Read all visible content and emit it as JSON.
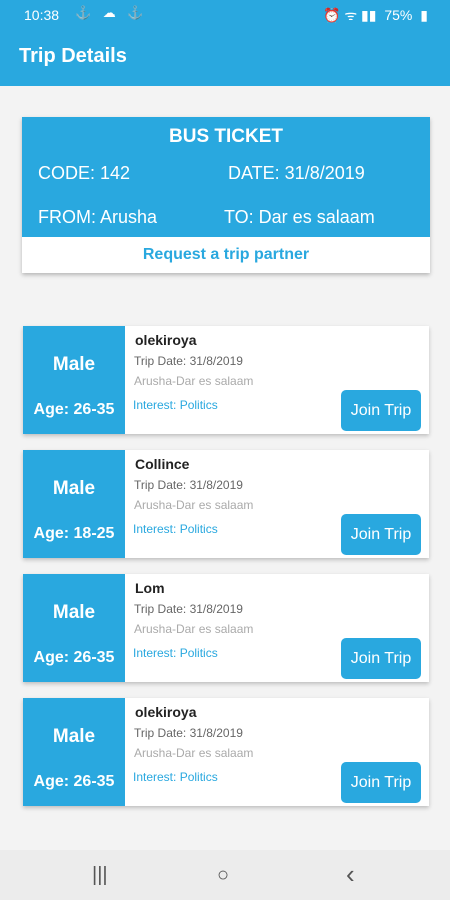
{
  "status": {
    "time": "10:38",
    "left_icons": "⚓ ☁ ⚓",
    "right_icons": "⏰ ᯤ ▮▮",
    "battery_percent": "75%",
    "battery_icon": "▮"
  },
  "appbar": {
    "title": "Trip Details"
  },
  "ticket": {
    "title": "BUS TICKET",
    "code": "CODE: 142",
    "date": "DATE: 31/8/2019",
    "from": "FROM: Arusha",
    "to": "TO: Dar es salaam",
    "request_label": "Request a trip partner"
  },
  "partners": [
    {
      "gender": "Male",
      "age": "Age: 26-35",
      "name": "olekiroya",
      "date": "Trip Date: 31/8/2019",
      "route": "Arusha-Dar es salaam",
      "interest": "Interest: Politics",
      "button": "Join Trip"
    },
    {
      "gender": "Male",
      "age": "Age: 18-25",
      "name": "Collince",
      "date": "Trip Date: 31/8/2019",
      "route": "Arusha-Dar es salaam",
      "interest": "Interest: Politics",
      "button": "Join Trip"
    },
    {
      "gender": "Male",
      "age": "Age: 26-35",
      "name": "Lom",
      "date": "Trip Date: 31/8/2019",
      "route": "Arusha-Dar es salaam",
      "interest": "Interest: Politics",
      "button": "Join Trip"
    },
    {
      "gender": "Male",
      "age": "Age: 26-35",
      "name": "olekiroya",
      "date": "Trip Date: 31/8/2019",
      "route": "Arusha-Dar es salaam",
      "interest": "Interest: Politics",
      "button": "Join Trip"
    }
  ],
  "navbar": {
    "recent": "|||",
    "home": "○",
    "back": "‹"
  },
  "colors": {
    "primary": "#29a8df",
    "background": "#f3f3f3"
  }
}
